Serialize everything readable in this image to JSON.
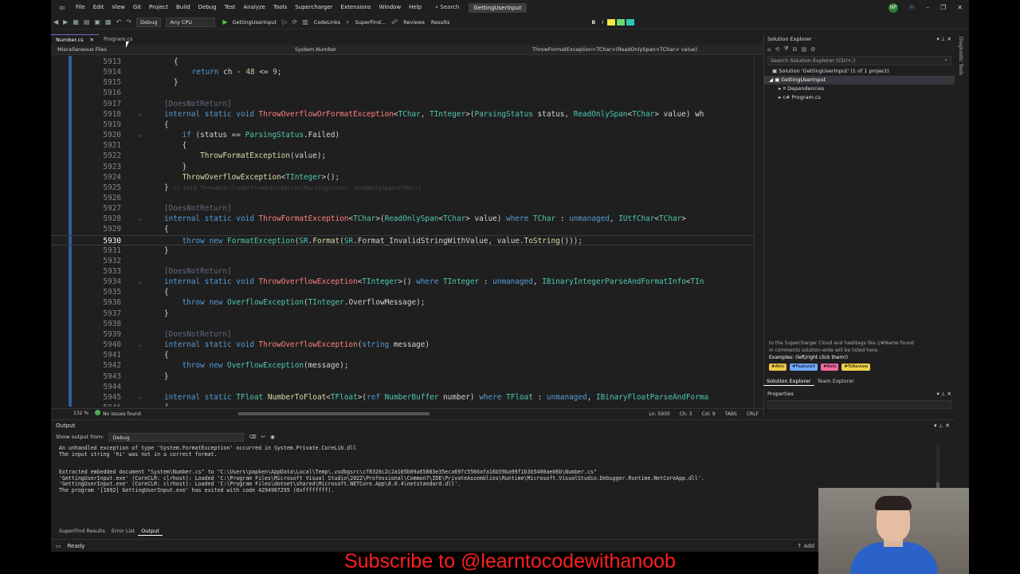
{
  "menubar": {
    "items": [
      "File",
      "Edit",
      "View",
      "Git",
      "Project",
      "Build",
      "Debug",
      "Test",
      "Analyze",
      "Tools",
      "Supercharger",
      "Extensions",
      "Window",
      "Help"
    ],
    "search_label": "Search",
    "solution_title": "GettingUserInput",
    "user_initials": "NP"
  },
  "toolbar": {
    "config": "Debug",
    "platform": "Any CPU",
    "run_target": "GettingUserInput",
    "codelinks": "CodeLinks",
    "superfind": "SuperFind...",
    "reviews": "Reviews",
    "results": "Results",
    "bold": "B",
    "italic": "I",
    "colors": {
      "yellow": "#f5e642",
      "green": "#6dd86d",
      "teal": "#2dc7b8"
    }
  },
  "doc_tabs": [
    {
      "label": "Number.cs",
      "active": true
    },
    {
      "label": "Program.cs",
      "active": false
    }
  ],
  "navbar": {
    "project": "Miscellaneous Files",
    "type": "System.Number",
    "member": "ThrowFormatException<TChar>(ReadOnlySpan<TChar> value)"
  },
  "editor": {
    "lines": [
      {
        "n": "5913",
        "html": "{"
      },
      {
        "n": "5914",
        "html": "    <span class='kw'>return</span> ch - <span class='num'>48</span> &lt;= <span class='num'>9</span>;"
      },
      {
        "n": "5915",
        "html": "}"
      },
      {
        "n": "5916",
        "html": ""
      },
      {
        "n": "5917",
        "html": "<span class='attr'>[DoesNotReturn]</span>"
      },
      {
        "n": "5918",
        "html": "<span class='kw'>internal static void</span> <span class='mthR'>ThrowOverflowOrFormatException</span>&lt;<span class='ty'>TChar</span>, <span class='ty'>TInteger</span>&gt;(<span class='ty'>ParsingStatus</span> status, <span class='ty'>ReadOnlySpan</span>&lt;<span class='ty'>TChar</span>&gt; value) wh"
      },
      {
        "n": "5919",
        "html": "{"
      },
      {
        "n": "5920",
        "html": "    <span class='kw'>if</span> (status == <span class='ty'>ParsingStatus</span>.Failed)"
      },
      {
        "n": "5921",
        "html": "    {"
      },
      {
        "n": "5922",
        "html": "        <span class='mth'>ThrowFormatException</span>(value);"
      },
      {
        "n": "5923",
        "html": "    }"
      },
      {
        "n": "5924",
        "html": "    <span class='mth'>ThrowOverflowException</span>&lt;<span class='ty'>TInteger</span>&gt;();"
      },
      {
        "n": "5925",
        "html": "} <span class='ghost'>// void ThrowOverflowOrFormatException(ParsingStatus, ReadOnlySpan&lt;TChar&gt;)</span>"
      },
      {
        "n": "5926",
        "html": ""
      },
      {
        "n": "5927",
        "html": "<span class='attr'>[DoesNotReturn]</span>"
      },
      {
        "n": "5928",
        "html": "<span class='kw'>internal static void</span> <span class='mthR'>ThrowFormatException</span>&lt;<span class='ty'>TChar</span>&gt;(<span class='ty'>ReadOnlySpan</span>&lt;<span class='ty'>TChar</span>&gt; value) <span class='kw'>where</span> <span class='ty'>TChar</span> : <span class='kw'>unmanaged</span>, <span class='ty'>IUtfChar</span>&lt;<span class='ty'>TChar</span>&gt;"
      },
      {
        "n": "5929",
        "html": "{"
      },
      {
        "n": "5930",
        "html": "    <span class='kw'>throw new</span> <span class='ty'>FormatException</span>(<span class='ty'>SR</span>.<span class='mth'>Format</span>(<span class='ty'>SR</span>.Format_InvalidStringWithValue, value.<span class='mth'>ToString</span>()));",
        "current": true
      },
      {
        "n": "5931",
        "html": "}"
      },
      {
        "n": "5932",
        "html": ""
      },
      {
        "n": "5933",
        "html": "<span class='attr'>[DoesNotReturn]</span>"
      },
      {
        "n": "5934",
        "html": "<span class='kw'>internal static void</span> <span class='mthR'>ThrowOverflowException</span>&lt;<span class='ty'>TInteger</span>&gt;() <span class='kw'>where</span> <span class='ty'>TInteger</span> : <span class='kw'>unmanaged</span>, <span class='ty'>IBinaryIntegerParseAndFormatInfo</span>&lt;<span class='ty'>TIn</span>"
      },
      {
        "n": "5935",
        "html": "{"
      },
      {
        "n": "5936",
        "html": "    <span class='kw'>throw new</span> <span class='ty'>OverflowException</span>(<span class='ty'>TInteger</span>.OverflowMessage);"
      },
      {
        "n": "5937",
        "html": "}"
      },
      {
        "n": "5938",
        "html": ""
      },
      {
        "n": "5939",
        "html": "<span class='attr'>[DoesNotReturn]</span>"
      },
      {
        "n": "5940",
        "html": "<span class='kw'>internal static void</span> <span class='mthR'>ThrowOverflowException</span>(<span class='kw'>string</span> message)"
      },
      {
        "n": "5941",
        "html": "{"
      },
      {
        "n": "5942",
        "html": "    <span class='kw'>throw new</span> <span class='ty'>OverflowException</span>(message);"
      },
      {
        "n": "5943",
        "html": "}"
      },
      {
        "n": "5944",
        "html": ""
      },
      {
        "n": "5945",
        "html": "<span class='kw'>internal static</span> <span class='ty'>TFloat</span> <span class='mth'>NumberToFloat</span>&lt;<span class='ty'>TFloat</span>&gt;(<span class='kw'>ref</span> <span class='ty'>NumberBuffer</span> number) <span class='kw'>where</span> <span class='ty'>TFloat</span> : <span class='kw'>unmanaged</span>, <span class='ty'>IBinaryFloatParseAndForma</span>"
      },
      {
        "n": "5946",
        "html": "{"
      }
    ]
  },
  "editor_status": {
    "zoom": "132 %",
    "issues": "No issues found",
    "ln": "Ln: 5930",
    "ch": "Ch: 3",
    "col": "Col: 9",
    "tabs": "TABS",
    "crlf": "CRLF"
  },
  "solution_explorer": {
    "title": "Solution Explorer",
    "search_placeholder": "Search Solution Explorer (Ctrl+;)",
    "solution": "Solution 'GettingUserInput' (1 of 1 project)",
    "project": "GettingUserInput",
    "dependencies": "Dependencies",
    "program": "Program.cs",
    "hint_line1": "to the Supercharger Cloud and hashtags like //#Name found",
    "hint_line2": "in comments solution-wide will be listed here.",
    "hint_line3": "Examples: (left/right click them!)",
    "tags": [
      {
        "label": "#Attn",
        "color": "#f0c94a"
      },
      {
        "label": "#FeatureX",
        "color": "#6fa8ff"
      },
      {
        "label": "#Refs",
        "color": "#f26aa0"
      },
      {
        "label": "#ToReview",
        "color": "#f0d24a"
      }
    ],
    "tab_solution": "Solution Explorer",
    "tab_team": "Team Explorer"
  },
  "properties": {
    "title": "Properties"
  },
  "right_strip": {
    "label": "Diagnostic Tools"
  },
  "output": {
    "title": "Output",
    "show_from_label": "Show output from:",
    "show_from_value": "Debug",
    "text": "An unhandled exception of type 'System.FormatException' occurred in System.Private.CoreLib.dll\nThe input string 'hi' was not in a correct format.\n\n\nExtracted embedded document \"System\\Number.cs\" to \"C:\\Users\\papken\\AppData\\Local\\Temp\\.vsdbgsrc\\cf8326c2c2a105b09a65883e35eca697c5566afa16b59ba99f1b3b5400ae08b\\Number.cs\"\n'GettingUserInput.exe' (CoreCLR: clrhost): Loaded 'C:\\Program Files\\Microsoft Visual Studio\\2022\\Professional\\Common7\\IDE\\PrivateAssemblies\\Runtime\\Microsoft.VisualStudio.Debugger.Runtime.NetCoreApp.dll'.\n'GettingUserInput.exe' (CoreCLR: clrhost): Loaded 'C:\\Program Files\\dotnet\\shared\\Microsoft.NETCore.App\\8.0.4\\netstandard.dll'.\nThe program '[1692] GettingUserInput.exe' has exited with code 4294967295 (0xffffffff)."
  },
  "bottom_tabs": [
    "SuperFind Results",
    "Error List",
    "Output"
  ],
  "statusbar": {
    "ready": "Ready",
    "right": "Add"
  },
  "caption": "Subscribe to @learntocodewithanoob"
}
